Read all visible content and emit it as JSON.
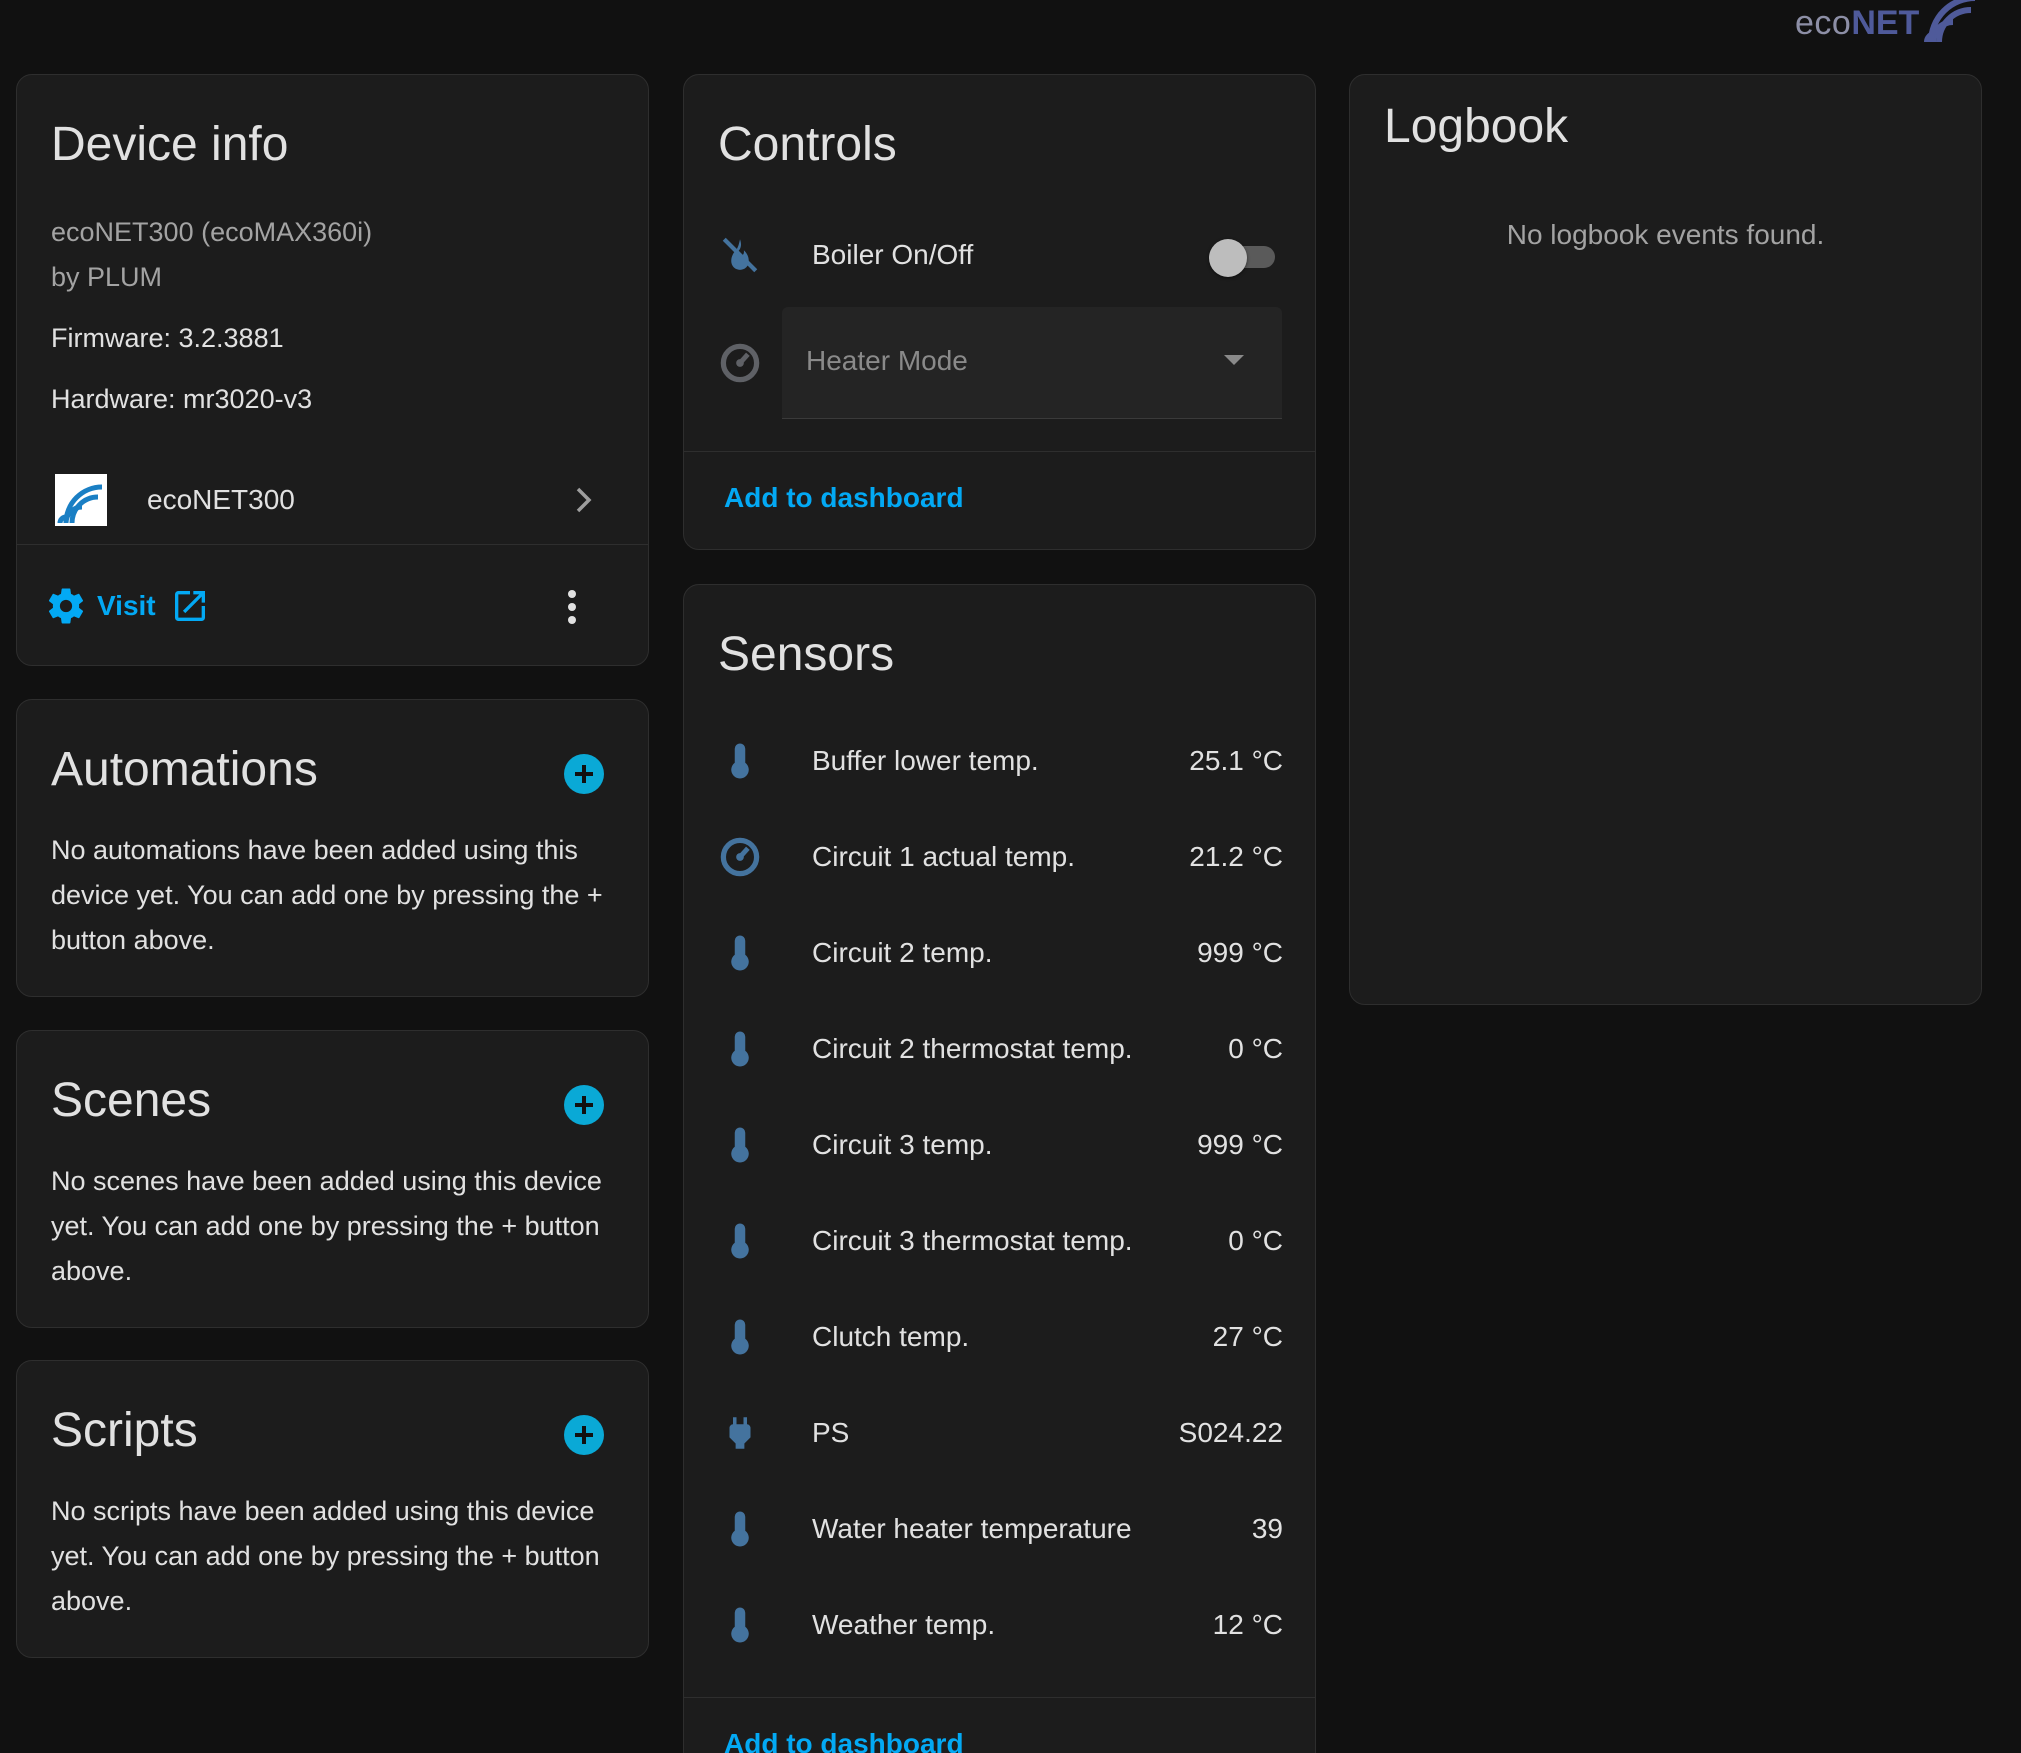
{
  "logo": {
    "part1": "eco",
    "part2": "NET"
  },
  "device_info": {
    "title": "Device info",
    "model": "ecoNET300 (ecoMAX360i)",
    "manufacturer": "by PLUM",
    "firmware": "Firmware: 3.2.3881",
    "hardware": "Hardware: mr3020-v3",
    "integration_name": "ecoNET300",
    "visit_label": "Visit"
  },
  "automations": {
    "title": "Automations",
    "empty_text": "No automations have been added using this device yet. You can add one by pressing the + button above."
  },
  "scenes": {
    "title": "Scenes",
    "empty_text": "No scenes have been added using this device yet. You can add one by pressing the + button above."
  },
  "scripts": {
    "title": "Scripts",
    "empty_text": "No scripts have been added using this device yet. You can add one by pressing the + button above."
  },
  "controls": {
    "title": "Controls",
    "boiler_label": "Boiler On/Off",
    "boiler_on": false,
    "heater_mode_placeholder": "Heater Mode",
    "add_to_dashboard": "Add to dashboard"
  },
  "sensors": {
    "title": "Sensors",
    "items": [
      {
        "icon": "thermometer-icon",
        "label": "Buffer lower temp.",
        "value": "25.1 °C"
      },
      {
        "icon": "gauge-icon",
        "label": "Circuit 1 actual temp.",
        "value": "21.2 °C"
      },
      {
        "icon": "thermometer-icon",
        "label": "Circuit 2 temp.",
        "value": "999 °C"
      },
      {
        "icon": "thermometer-icon",
        "label": "Circuit 2 thermostat temp.",
        "value": "0 °C"
      },
      {
        "icon": "thermometer-icon",
        "label": "Circuit 3 temp.",
        "value": "999 °C"
      },
      {
        "icon": "thermometer-icon",
        "label": "Circuit 3 thermostat temp.",
        "value": "0 °C"
      },
      {
        "icon": "thermometer-icon",
        "label": "Clutch temp.",
        "value": "27 °C"
      },
      {
        "icon": "plug-icon",
        "label": "PS",
        "value": "S024.22"
      },
      {
        "icon": "thermometer-icon",
        "label": "Water heater temperature",
        "value": "39"
      },
      {
        "icon": "thermometer-icon",
        "label": "Weather temp.",
        "value": "12 °C"
      }
    ],
    "add_to_dashboard": "Add to dashboard"
  },
  "logbook": {
    "title": "Logbook",
    "empty_text": "No logbook events found."
  },
  "colors": {
    "background": "#111111",
    "card": "#1c1c1c",
    "accent": "#03a9f4",
    "icon": "#44739e"
  }
}
